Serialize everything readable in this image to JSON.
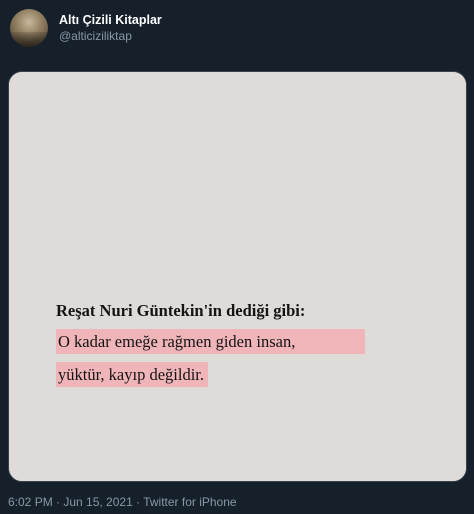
{
  "tweet": {
    "display_name": "Altı Çizili Kitaplar",
    "handle": "@alticiziliktap"
  },
  "image": {
    "title": "Reşat Nuri Güntekin'in dediği gibi:",
    "line1": "O kadar emeğe rağmen giden insan,",
    "line2": "yüktür, kayıp değildir.",
    "highlight_color": "#efb5b8"
  },
  "footer": {
    "meta": "6:02 PM · Jun 15, 2021 · Twitter for iPhone"
  }
}
